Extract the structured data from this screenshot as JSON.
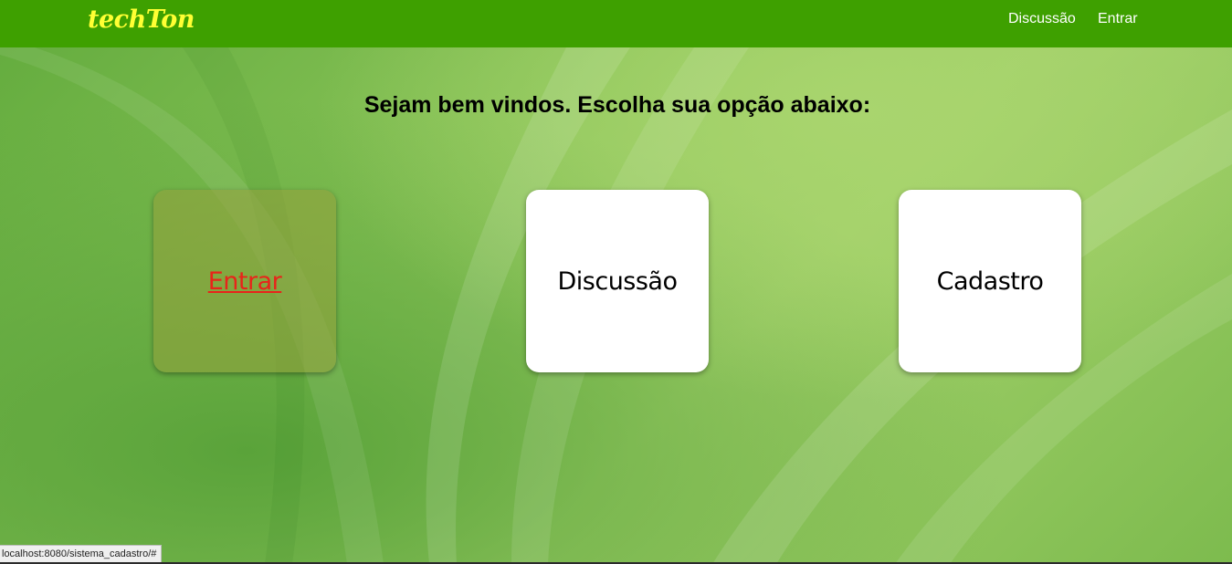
{
  "navbar": {
    "brand": "techTon",
    "links": [
      "Discussão",
      "Entrar"
    ]
  },
  "main": {
    "headline": "Sejam bem vindos. Escolha sua opção abaixo:",
    "cards": [
      {
        "label": "Entrar",
        "state": "hovered"
      },
      {
        "label": "Discussão"
      },
      {
        "label": "Cadastro"
      }
    ]
  },
  "status_bar": {
    "url": "localhost:8080/sistema_cadastro/#"
  },
  "colors": {
    "navbar": "#3ea000",
    "brand": "#ffff33",
    "hover_link": "#e8241a",
    "background": "#8cc55a"
  }
}
